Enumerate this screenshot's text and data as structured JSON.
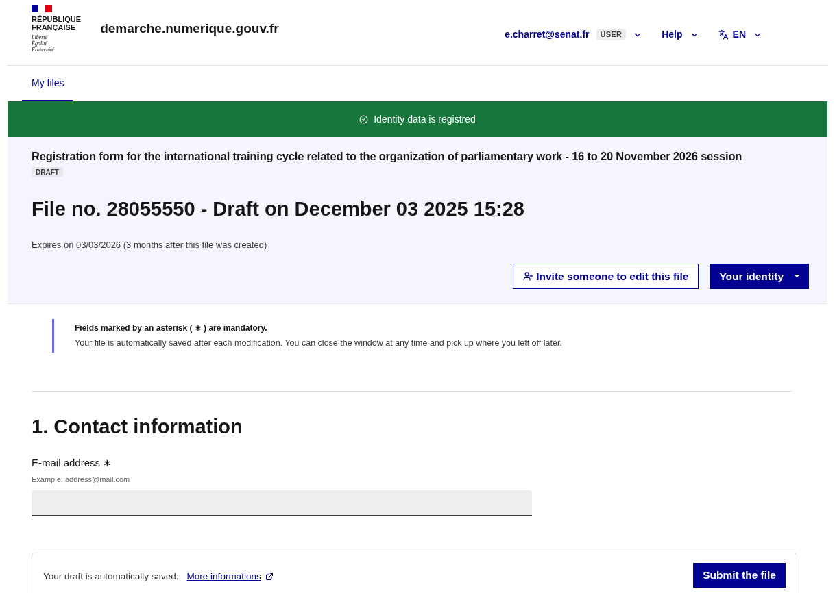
{
  "logo": {
    "lines": [
      "RÉPUBLIQUE",
      "FRANÇAISE"
    ],
    "motto": [
      "Liberté",
      "Égalité",
      "Fraternité"
    ]
  },
  "site_name": "demarche.numerique.gouv.fr",
  "header_links": [
    {
      "kind": "account",
      "label": "e.charret@senat.fr",
      "badge": "USER"
    },
    {
      "kind": "menu",
      "label": "Help"
    },
    {
      "kind": "language",
      "label": "EN"
    }
  ],
  "tabs": [
    {
      "label": "My files",
      "selected": true
    }
  ],
  "notice": {
    "text": "Identity data is registred"
  },
  "procedure": {
    "title": "Registration form for the international training cycle related to the organization of parliamentary work - 16 to 20 November 2026 session",
    "status": "DRAFT"
  },
  "file_title": "File no. 28055550 - Draft on December 03 2025 15:28",
  "expiry": "Expires on 03/03/2026 (3 months after this file was created)",
  "actions": [
    {
      "kind": "secondary",
      "label": "Invite someone to edit this file"
    },
    {
      "kind": "primary",
      "label": "Your identity"
    }
  ],
  "callout": {
    "title": "Fields marked by an asterisk ( ∗ ) are mandatory.",
    "text": "Your file is automatically saved after each modification. You can close the window at any time and pick up where you left off later."
  },
  "section_title": "1. Contact information",
  "required_mark": "∗",
  "fields": [
    {
      "label": "E-mail address",
      "required": true,
      "hint": "Example: address@mail.com"
    }
  ],
  "footer": {
    "text": "Your draft is automatically saved.",
    "link": "More informations",
    "button": "Submit the file"
  }
}
